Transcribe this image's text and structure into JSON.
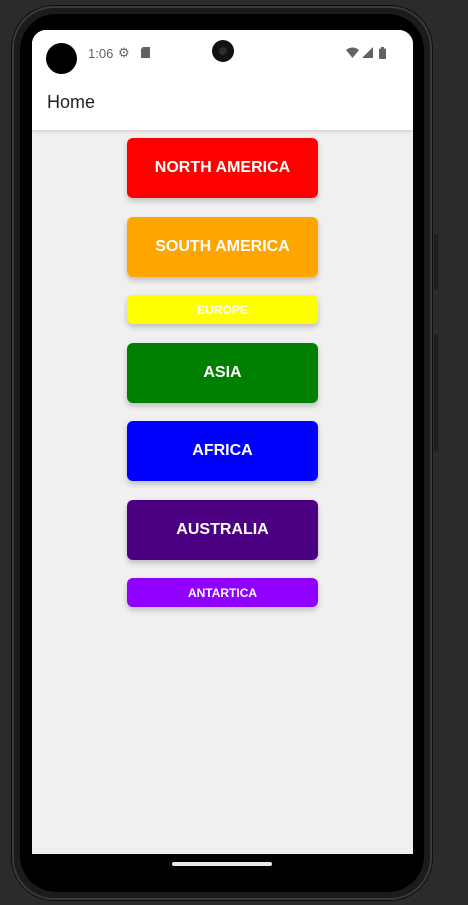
{
  "status_bar": {
    "time": "1:06",
    "icons": [
      "gear-icon",
      "sd-card-icon",
      "wifi-icon",
      "signal-icon",
      "battery-icon"
    ]
  },
  "app_bar": {
    "title": "Home"
  },
  "continents": [
    {
      "label": "NORTH AMERICA",
      "color": "#ff0000"
    },
    {
      "label": "SOUTH AMERICA",
      "color": "#ffa500"
    },
    {
      "label": "EUROPE",
      "color": "#ffff00"
    },
    {
      "label": "ASIA",
      "color": "#008000"
    },
    {
      "label": "AFRICA",
      "color": "#0000ff"
    },
    {
      "label": "AUSTRALIA",
      "color": "#4b0082"
    },
    {
      "label": "ANTARTICA",
      "color": "#8f00ff"
    }
  ]
}
